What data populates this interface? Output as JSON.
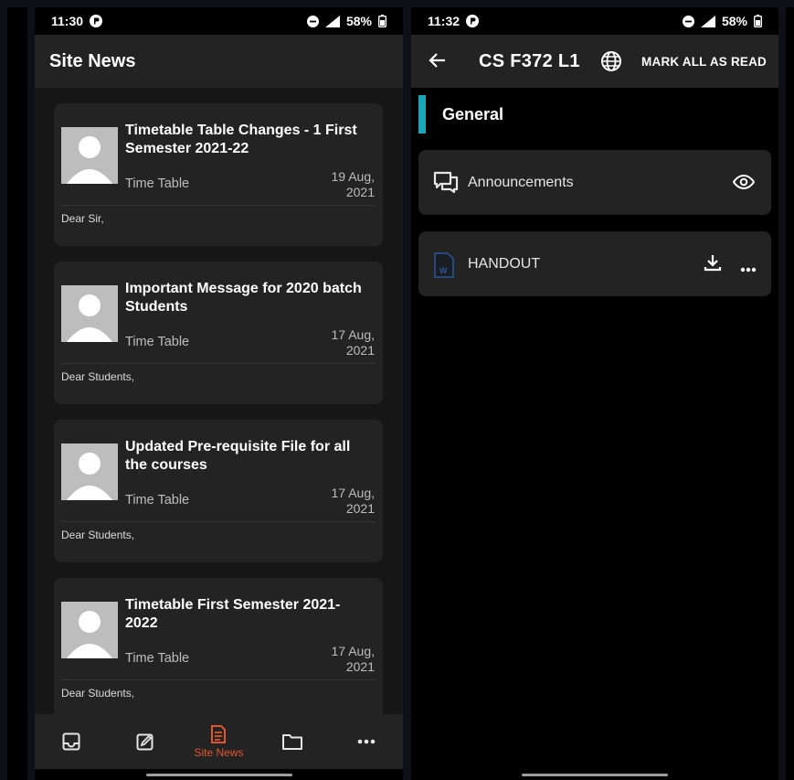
{
  "left_screen": {
    "status": {
      "time": "11:30",
      "battery": "58%"
    },
    "appbar_title": "Site News",
    "posts": [
      {
        "title": "Timetable Table Changes - 1 First Semester 2021-22",
        "author": "Time Table",
        "date_line1": "19 Aug,",
        "date_line2": "2021",
        "preview": "Dear Sir,"
      },
      {
        "title": "Important Message for 2020 batch Students",
        "author": "Time Table",
        "date_line1": "17 Aug,",
        "date_line2": "2021",
        "preview": "Dear Students,"
      },
      {
        "title": "Updated Pre-requisite File for all the courses",
        "author": "Time Table",
        "date_line1": "17 Aug,",
        "date_line2": "2021",
        "preview": "Dear Students,"
      },
      {
        "title": "Timetable First Semester 2021-2022",
        "author": "Time Table",
        "date_line1": "17 Aug,",
        "date_line2": "2021",
        "preview": "Dear Students,"
      }
    ],
    "bottom_nav": {
      "items": [
        {
          "icon": "inbox-icon"
        },
        {
          "icon": "edit-note-icon"
        },
        {
          "icon": "news-document-icon",
          "label": "Site News",
          "active": true
        },
        {
          "icon": "folder-icon"
        },
        {
          "icon": "more-horizontal-icon"
        }
      ]
    }
  },
  "right_screen": {
    "status": {
      "time": "11:32",
      "battery": "58%"
    },
    "course_title": "CS F372 L1",
    "mark_all_label": "MARK ALL AS READ",
    "section_title": "General",
    "modules": [
      {
        "label": "Announcements",
        "icon": "forum-icon",
        "action": "eye-icon"
      },
      {
        "label": "HANDOUT",
        "icon": "word-file-icon",
        "action": "download-icon"
      }
    ]
  },
  "colors": {
    "accent_active": "#e2562d",
    "section_accent": "#19a6b7",
    "card_bg": "#232323",
    "word_blue": "#2b579a"
  }
}
